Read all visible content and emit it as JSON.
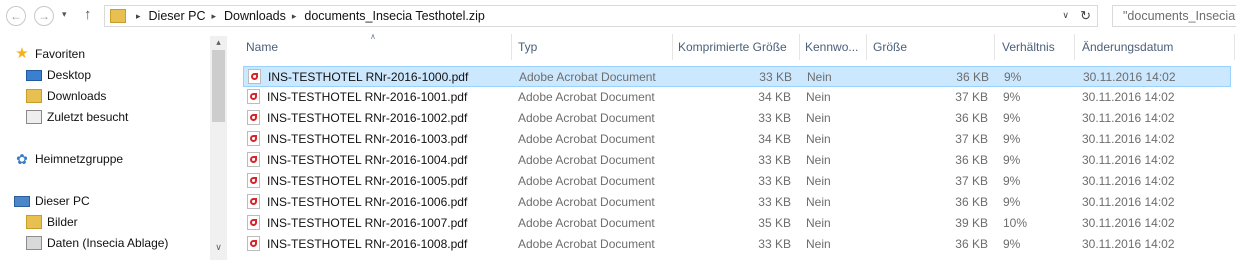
{
  "nav": {
    "back_glyph": "←",
    "forward_glyph": "→",
    "history_glyph": "▾",
    "up_glyph": "↑"
  },
  "address": {
    "crumbs": [
      "Dieser PC",
      "Downloads",
      "documents_Insecia Testhotel.zip"
    ],
    "separator": "▸",
    "dropdown_glyph": "∨",
    "refresh_glyph": "↻"
  },
  "search": {
    "placeholder": "\"documents_Insecia T"
  },
  "sidebar": {
    "favorites_label": "Favoriten",
    "favorites_items": [
      "Desktop",
      "Downloads",
      "Zuletzt besucht"
    ],
    "homegroup_label": "Heimnetzgruppe",
    "pc_label": "Dieser PC",
    "pc_items": [
      "Bilder",
      "Daten (Insecia Ablage)"
    ],
    "scroll_up": "▴",
    "scroll_down": "∨"
  },
  "columns": {
    "name": "Name",
    "type": "Typ",
    "compressed": "Komprimierte Größe",
    "password": "Kennwo...",
    "size": "Größe",
    "ratio": "Verhältnis",
    "date": "Änderungsdatum",
    "sort_glyph": "∧"
  },
  "files": [
    {
      "name": "INS-TESTHOTEL RNr-2016-1000.pdf",
      "type": "Adobe Acrobat Document",
      "compressed": "33 KB",
      "password": "Nein",
      "size": "36 KB",
      "ratio": "9%",
      "date": "30.11.2016 14:02"
    },
    {
      "name": "INS-TESTHOTEL RNr-2016-1001.pdf",
      "type": "Adobe Acrobat Document",
      "compressed": "34 KB",
      "password": "Nein",
      "size": "37 KB",
      "ratio": "9%",
      "date": "30.11.2016 14:02"
    },
    {
      "name": "INS-TESTHOTEL RNr-2016-1002.pdf",
      "type": "Adobe Acrobat Document",
      "compressed": "33 KB",
      "password": "Nein",
      "size": "36 KB",
      "ratio": "9%",
      "date": "30.11.2016 14:02"
    },
    {
      "name": "INS-TESTHOTEL RNr-2016-1003.pdf",
      "type": "Adobe Acrobat Document",
      "compressed": "34 KB",
      "password": "Nein",
      "size": "37 KB",
      "ratio": "9%",
      "date": "30.11.2016 14:02"
    },
    {
      "name": "INS-TESTHOTEL RNr-2016-1004.pdf",
      "type": "Adobe Acrobat Document",
      "compressed": "33 KB",
      "password": "Nein",
      "size": "36 KB",
      "ratio": "9%",
      "date": "30.11.2016 14:02"
    },
    {
      "name": "INS-TESTHOTEL RNr-2016-1005.pdf",
      "type": "Adobe Acrobat Document",
      "compressed": "33 KB",
      "password": "Nein",
      "size": "37 KB",
      "ratio": "9%",
      "date": "30.11.2016 14:02"
    },
    {
      "name": "INS-TESTHOTEL RNr-2016-1006.pdf",
      "type": "Adobe Acrobat Document",
      "compressed": "33 KB",
      "password": "Nein",
      "size": "36 KB",
      "ratio": "9%",
      "date": "30.11.2016 14:02"
    },
    {
      "name": "INS-TESTHOTEL RNr-2016-1007.pdf",
      "type": "Adobe Acrobat Document",
      "compressed": "35 KB",
      "password": "Nein",
      "size": "39 KB",
      "ratio": "10%",
      "date": "30.11.2016 14:02"
    },
    {
      "name": "INS-TESTHOTEL RNr-2016-1008.pdf",
      "type": "Adobe Acrobat Document",
      "compressed": "33 KB",
      "password": "Nein",
      "size": "36 KB",
      "ratio": "9%",
      "date": "30.11.2016 14:02"
    }
  ],
  "selected_index": 0,
  "colors": {
    "selection_bg": "#cce8ff",
    "selection_border": "#99d1ff",
    "header_text": "#4c607a",
    "pdf_red": "#d8232a"
  }
}
